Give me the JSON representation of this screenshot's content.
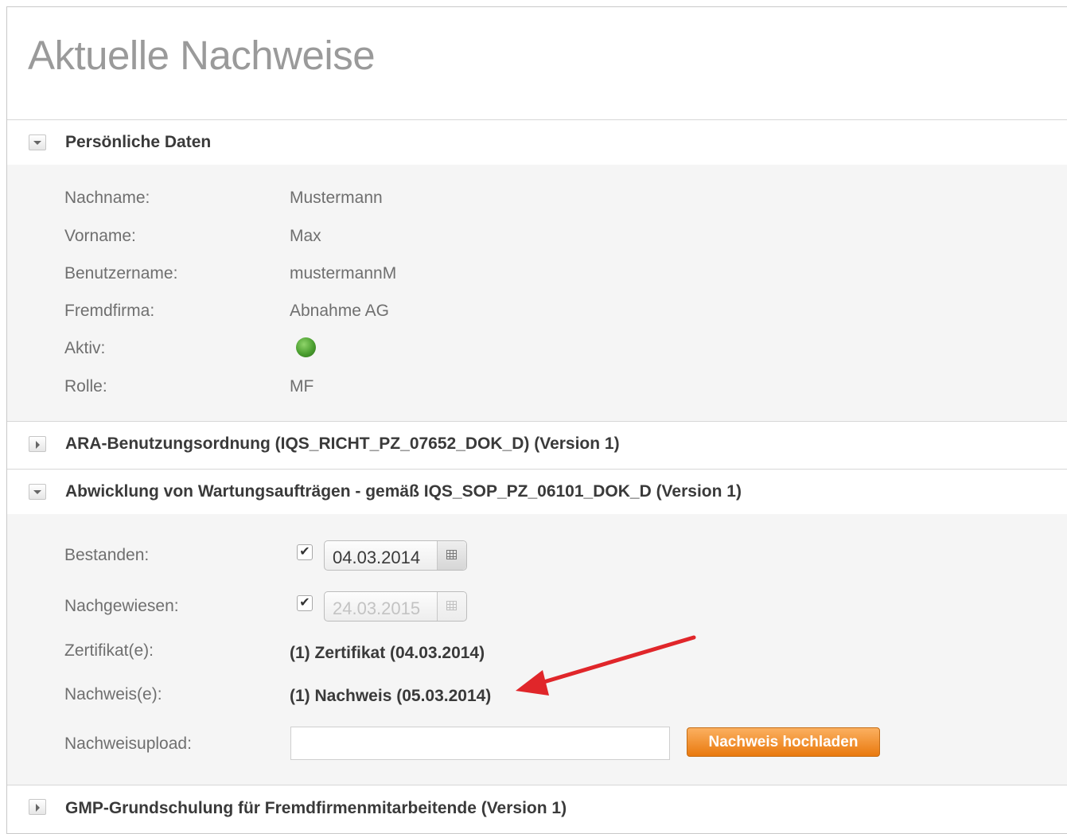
{
  "page_title": "Aktuelle Nachweise",
  "sections": {
    "personal": {
      "title": "Persönliche Daten",
      "rows": [
        {
          "label": "Nachname:",
          "value": "Mustermann"
        },
        {
          "label": "Vorname:",
          "value": "Max"
        },
        {
          "label": "Benutzername:",
          "value": "mustermannM"
        },
        {
          "label": "Fremdfirma:",
          "value": "Abnahme AG"
        },
        {
          "label": "Aktiv:",
          "value_icon": "green-status-dot"
        },
        {
          "label": "Rolle:",
          "value": "MF"
        }
      ]
    },
    "ara": {
      "title": "ARA-Benutzungsordnung (IQS_RICHT_PZ_07652_DOK_D) (Version 1)"
    },
    "wartung": {
      "title": "Abwicklung von Wartungsaufträgen - gemäß IQS_SOP_PZ_06101_DOK_D (Version 1)",
      "bestanden_label": "Bestanden:",
      "bestanden_date": "04.03.2014",
      "nachgewiesen_label": "Nachgewiesen:",
      "nachgewiesen_date": "24.03.2015",
      "zertifikat_label": "Zertifikat(e):",
      "zertifikat_value": "(1) Zertifikat (04.03.2014)",
      "nachweis_label": "Nachweis(e):",
      "nachweis_value": "(1) Nachweis (05.03.2014)",
      "upload_label": "Nachweisupload:",
      "upload_value": "",
      "upload_button": "Nachweis hochladen"
    },
    "gmp": {
      "title": "GMP-Grundschulung für Fremdfirmenmitarbeitende (Version 1)"
    }
  },
  "colors": {
    "accent_button": "#e9790e",
    "annotation_arrow": "#e0262a",
    "active_status": "#4a9e2f"
  }
}
